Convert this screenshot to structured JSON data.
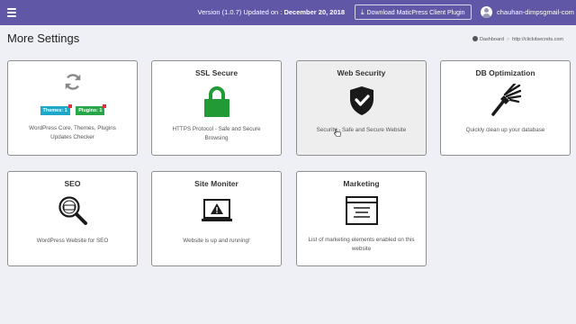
{
  "topbar": {
    "version_text": "Version (1.0.7) Updated on :",
    "version_date": "December 20, 2018",
    "download_label": "Download MaticPress Client Plugin",
    "username": "chauhan-dimpsgmail-com"
  },
  "page": {
    "title": "More Settings",
    "breadcrumb_home": "Dashboard",
    "breadcrumb_separator": ">",
    "breadcrumb_url": "http://clickitsecrets.com"
  },
  "cards": [
    {
      "title": "",
      "badges": [
        {
          "label": "Themes: 1"
        },
        {
          "label": "Plugins: 1"
        }
      ],
      "desc": "WordPress Core, Themes, Plugins Updates Checker",
      "icon": "refresh-icon"
    },
    {
      "title": "SSL Secure",
      "desc": "HTTPS Protocol - Safe and Secure Browsing",
      "icon": "padlock-icon"
    },
    {
      "title": "Web Security",
      "desc": "Security - Safe and Secure Website",
      "icon": "shield-check-icon"
    },
    {
      "title": "DB Optimization",
      "desc": "Quickly clean up your database",
      "icon": "broom-icon"
    },
    {
      "title": "SEO",
      "desc": "WordPress Website for SEO",
      "icon": "seo-magnifier-icon"
    },
    {
      "title": "Site Moniter",
      "desc": "Website is up and running!",
      "icon": "laptop-warning-icon"
    },
    {
      "title": "Marketing",
      "desc": "List of marketing elements enabled on this website",
      "icon": "browser-window-icon"
    }
  ],
  "colors": {
    "topbar": "#6057a6",
    "ssl_green": "#229a36",
    "themes_badge": "#1ea7c6",
    "plugins_badge": "#2aa64a"
  }
}
